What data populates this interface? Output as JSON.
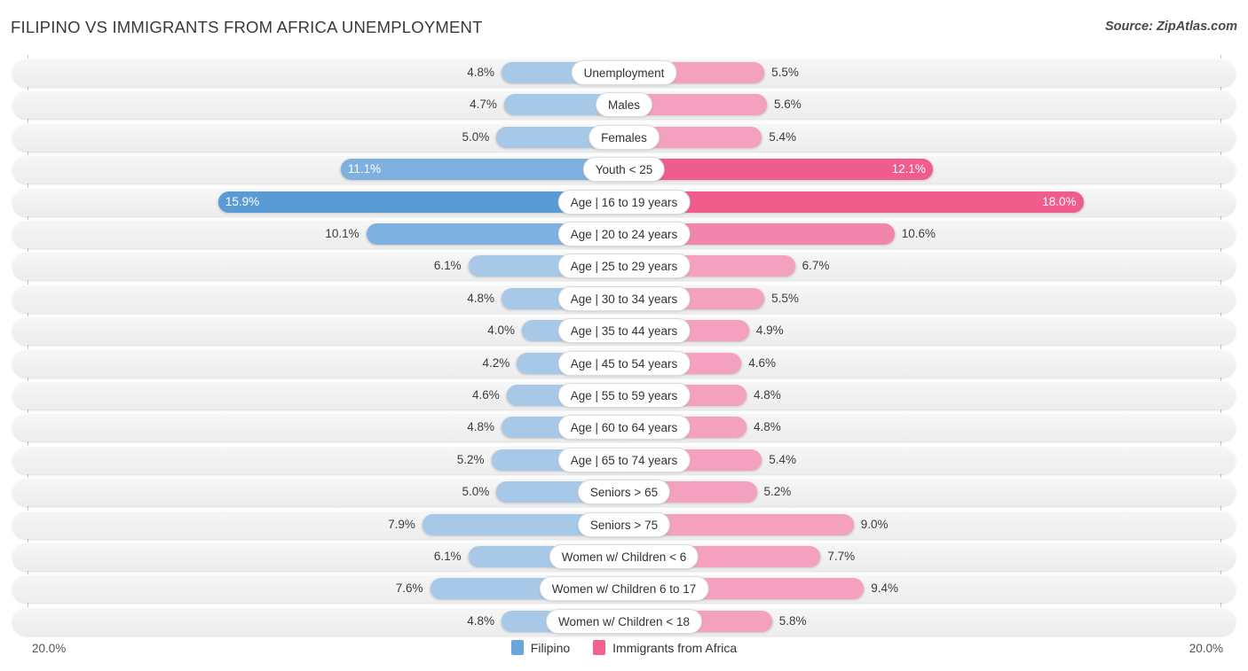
{
  "header": {
    "title": "FILIPINO VS IMMIGRANTS FROM AFRICA UNEMPLOYMENT",
    "source": "Source: ZipAtlas.com"
  },
  "axis": {
    "left_tick": "20.0%",
    "right_tick": "20.0%"
  },
  "legend": [
    {
      "label": "Filipino",
      "color": "#6aa6dd"
    },
    {
      "label": "Immigrants from Africa",
      "color": "#f2628f"
    }
  ],
  "colors": {
    "blue_light": "#a8c8e8",
    "blue_mid": "#7eb0e0",
    "blue_dark": "#5b9bd5",
    "pink_light": "#f4a0bf",
    "pink_mid": "#f285ab",
    "pink_dark": "#f05c8c",
    "row_bg": "#f2f2f2",
    "axis": "#c9c9c9"
  },
  "chart_data": {
    "type": "bar",
    "subtype": "diverging-bidirectional",
    "title": "FILIPINO VS IMMIGRANTS FROM AFRICA UNEMPLOYMENT",
    "xlabel": "",
    "ylabel": "",
    "xlim": [
      20.0,
      20.0
    ],
    "axis_max": 20.0,
    "unit": "%",
    "grid": false,
    "legend_position": "bottom-center",
    "categories": [
      "Unemployment",
      "Males",
      "Females",
      "Youth < 25",
      "Age | 16 to 19 years",
      "Age | 20 to 24 years",
      "Age | 25 to 29 years",
      "Age | 30 to 34 years",
      "Age | 35 to 44 years",
      "Age | 45 to 54 years",
      "Age | 55 to 59 years",
      "Age | 60 to 64 years",
      "Age | 65 to 74 years",
      "Seniors > 65",
      "Seniors > 75",
      "Women w/ Children < 6",
      "Women w/ Children 6 to 17",
      "Women w/ Children < 18"
    ],
    "series": [
      {
        "name": "Filipino",
        "side": "left",
        "values": [
          4.8,
          4.7,
          5.0,
          11.1,
          15.9,
          10.1,
          6.1,
          4.8,
          4.0,
          4.2,
          4.6,
          4.8,
          5.2,
          5.0,
          7.9,
          6.1,
          7.6,
          4.8
        ],
        "labels": [
          "4.8%",
          "4.7%",
          "5.0%",
          "11.1%",
          "15.9%",
          "10.1%",
          "6.1%",
          "4.8%",
          "4.0%",
          "4.2%",
          "4.6%",
          "4.8%",
          "5.2%",
          "5.0%",
          "7.9%",
          "6.1%",
          "7.6%",
          "4.8%"
        ]
      },
      {
        "name": "Immigrants from Africa",
        "side": "right",
        "values": [
          5.5,
          5.6,
          5.4,
          12.1,
          18.0,
          10.6,
          6.7,
          5.5,
          4.9,
          4.6,
          4.8,
          4.8,
          5.4,
          5.2,
          9.0,
          7.7,
          9.4,
          5.8
        ],
        "labels": [
          "5.5%",
          "5.6%",
          "5.4%",
          "12.1%",
          "18.0%",
          "10.6%",
          "6.7%",
          "5.5%",
          "4.9%",
          "4.6%",
          "4.8%",
          "4.8%",
          "5.4%",
          "5.2%",
          "9.0%",
          "7.7%",
          "9.4%",
          "5.8%"
        ]
      }
    ]
  }
}
